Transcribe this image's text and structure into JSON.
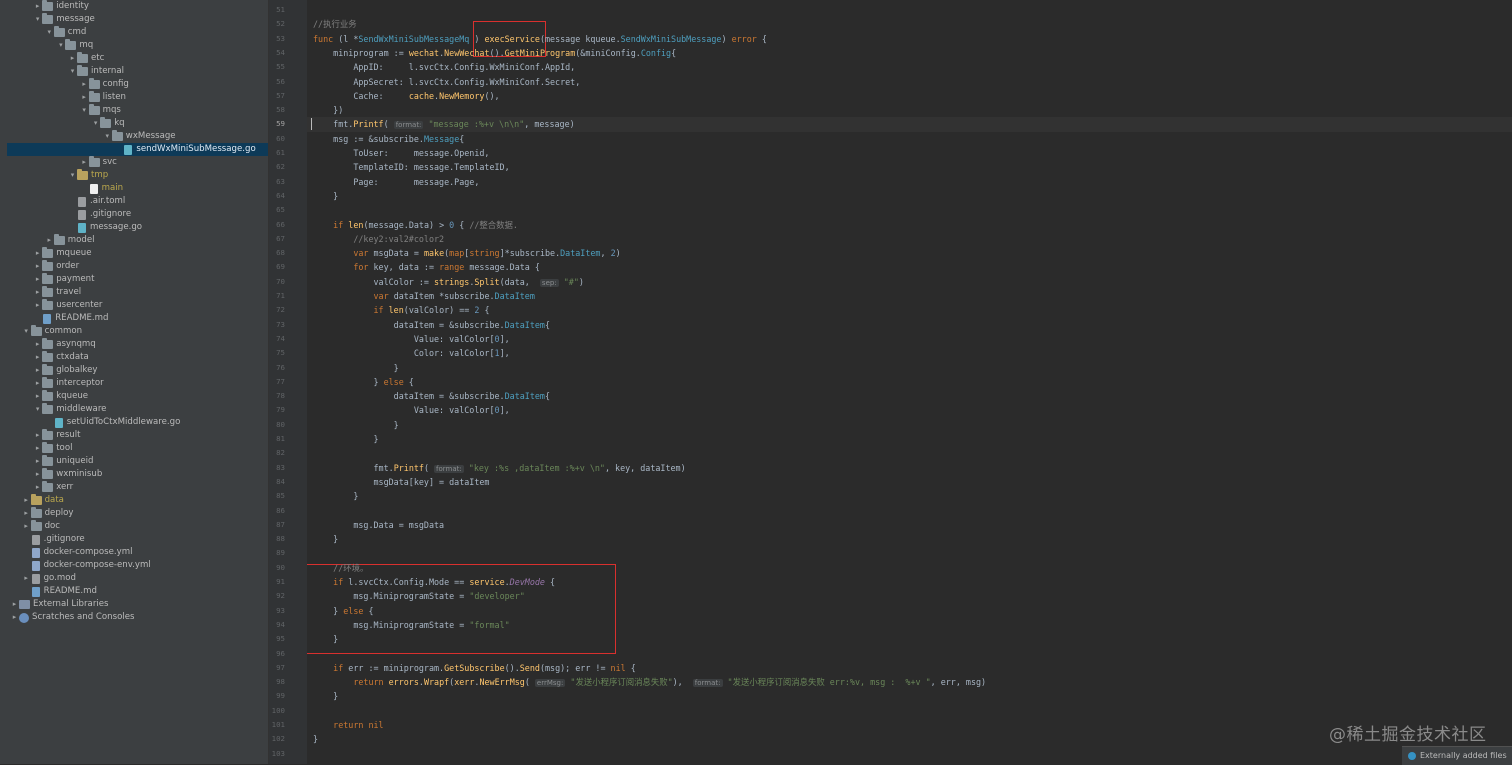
{
  "tree": [
    {
      "label": "identity",
      "depth": 2,
      "kind": "folder",
      "arrow": "▸"
    },
    {
      "label": "message",
      "depth": 2,
      "kind": "folder",
      "arrow": "▾"
    },
    {
      "label": "cmd",
      "depth": 3,
      "kind": "folder",
      "arrow": "▾"
    },
    {
      "label": "mq",
      "depth": 4,
      "kind": "folder",
      "arrow": "▾"
    },
    {
      "label": "etc",
      "depth": 5,
      "kind": "folder",
      "arrow": "▸"
    },
    {
      "label": "internal",
      "depth": 5,
      "kind": "folder",
      "arrow": "▾"
    },
    {
      "label": "config",
      "depth": 6,
      "kind": "folder",
      "arrow": "▸"
    },
    {
      "label": "listen",
      "depth": 6,
      "kind": "folder",
      "arrow": "▸"
    },
    {
      "label": "mqs",
      "depth": 6,
      "kind": "folder",
      "arrow": "▾"
    },
    {
      "label": "kq",
      "depth": 7,
      "kind": "folder",
      "arrow": "▾"
    },
    {
      "label": "wxMessage",
      "depth": 8,
      "kind": "folder",
      "arrow": "▾"
    },
    {
      "label": "sendWxMiniSubMessage.go",
      "depth": 9,
      "kind": "go",
      "arrow": "",
      "selected": true
    },
    {
      "label": "svc",
      "depth": 6,
      "kind": "folder",
      "arrow": "▸"
    },
    {
      "label": "tmp",
      "depth": 5,
      "kind": "folder-y",
      "arrow": "▾",
      "color": "yellow"
    },
    {
      "label": "main",
      "depth": 6,
      "kind": "main",
      "arrow": "",
      "color": "yellow"
    },
    {
      "label": ".air.toml",
      "depth": 5,
      "kind": "cfg",
      "arrow": ""
    },
    {
      "label": ".gitignore",
      "depth": 5,
      "kind": "cfg",
      "arrow": ""
    },
    {
      "label": "message.go",
      "depth": 5,
      "kind": "go",
      "arrow": ""
    },
    {
      "label": "model",
      "depth": 3,
      "kind": "folder",
      "arrow": "▸"
    },
    {
      "label": "mqueue",
      "depth": 2,
      "kind": "folder",
      "arrow": "▸"
    },
    {
      "label": "order",
      "depth": 2,
      "kind": "folder",
      "arrow": "▸"
    },
    {
      "label": "payment",
      "depth": 2,
      "kind": "folder",
      "arrow": "▸"
    },
    {
      "label": "travel",
      "depth": 2,
      "kind": "folder",
      "arrow": "▸"
    },
    {
      "label": "usercenter",
      "depth": 2,
      "kind": "folder",
      "arrow": "▸"
    },
    {
      "label": "README.md",
      "depth": 2,
      "kind": "md",
      "arrow": ""
    },
    {
      "label": "common",
      "depth": 1,
      "kind": "folder",
      "arrow": "▾"
    },
    {
      "label": "asynqmq",
      "depth": 2,
      "kind": "folder",
      "arrow": "▸"
    },
    {
      "label": "ctxdata",
      "depth": 2,
      "kind": "folder",
      "arrow": "▸"
    },
    {
      "label": "globalkey",
      "depth": 2,
      "kind": "folder",
      "arrow": "▸"
    },
    {
      "label": "interceptor",
      "depth": 2,
      "kind": "folder",
      "arrow": "▸"
    },
    {
      "label": "kqueue",
      "depth": 2,
      "kind": "folder",
      "arrow": "▸"
    },
    {
      "label": "middleware",
      "depth": 2,
      "kind": "folder",
      "arrow": "▾"
    },
    {
      "label": "setUidToCtxMiddleware.go",
      "depth": 3,
      "kind": "go",
      "arrow": ""
    },
    {
      "label": "result",
      "depth": 2,
      "kind": "folder",
      "arrow": "▸"
    },
    {
      "label": "tool",
      "depth": 2,
      "kind": "folder",
      "arrow": "▸"
    },
    {
      "label": "uniqueid",
      "depth": 2,
      "kind": "folder",
      "arrow": "▸"
    },
    {
      "label": "wxminisub",
      "depth": 2,
      "kind": "folder",
      "arrow": "▸"
    },
    {
      "label": "xerr",
      "depth": 2,
      "kind": "folder",
      "arrow": "▸"
    },
    {
      "label": "data",
      "depth": 1,
      "kind": "folder-y",
      "arrow": "▸",
      "color": "yellow"
    },
    {
      "label": "deploy",
      "depth": 1,
      "kind": "folder",
      "arrow": "▸"
    },
    {
      "label": "doc",
      "depth": 1,
      "kind": "folder",
      "arrow": "▸"
    },
    {
      "label": ".gitignore",
      "depth": 1,
      "kind": "cfg",
      "arrow": ""
    },
    {
      "label": "docker-compose.yml",
      "depth": 1,
      "kind": "yml",
      "arrow": ""
    },
    {
      "label": "docker-compose-env.yml",
      "depth": 1,
      "kind": "yml",
      "arrow": ""
    },
    {
      "label": "go.mod",
      "depth": 1,
      "kind": "cfg",
      "arrow": "▸"
    },
    {
      "label": "README.md",
      "depth": 1,
      "kind": "md",
      "arrow": ""
    },
    {
      "label": "External Libraries",
      "depth": 0,
      "kind": "lib",
      "arrow": "▸"
    },
    {
      "label": "Scratches and Consoles",
      "depth": 0,
      "kind": "scr",
      "arrow": "▸"
    }
  ],
  "editor": {
    "current_line": 59,
    "lines": [
      {
        "n": 51,
        "t": []
      },
      {
        "n": 52,
        "t": [
          [
            "cm",
            "//执行业务"
          ]
        ]
      },
      {
        "n": 53,
        "t": [
          [
            "kw",
            "func "
          ],
          [
            "",
            "(l *"
          ],
          [
            "ty",
            "SendWxMiniSubMessageMq"
          ],
          [
            "",
            " ) "
          ],
          [
            "fn",
            "execService"
          ],
          [
            "",
            "(message kqueue."
          ],
          [
            "ty",
            "SendWxMiniSubMessage"
          ],
          [
            "",
            ") "
          ],
          [
            "kw",
            "error"
          ],
          [
            "",
            " {"
          ]
        ]
      },
      {
        "n": 54,
        "t": [
          [
            "",
            "    miniprogram := "
          ],
          [
            "fn",
            "wechat"
          ],
          [
            "",
            "."
          ],
          [
            "fn",
            "NewWechat"
          ],
          [
            "",
            "()."
          ],
          [
            "fn",
            "GetMiniProgram"
          ],
          [
            "",
            "(&miniConfig."
          ],
          [
            "ty",
            "Config"
          ],
          [
            "",
            "{"
          ]
        ]
      },
      {
        "n": 55,
        "t": [
          [
            "",
            "        AppID:     l.svcCtx.Config.WxMiniConf.AppId,"
          ]
        ]
      },
      {
        "n": 56,
        "t": [
          [
            "",
            "        AppSecret: l.svcCtx.Config.WxMiniConf.Secret,"
          ]
        ]
      },
      {
        "n": 57,
        "t": [
          [
            "",
            "        Cache:     "
          ],
          [
            "fn",
            "cache"
          ],
          [
            "",
            "."
          ],
          [
            "fn",
            "NewMemory"
          ],
          [
            "",
            "(),"
          ]
        ]
      },
      {
        "n": 58,
        "t": [
          [
            "",
            "    })"
          ]
        ]
      },
      {
        "n": 59,
        "t": [
          [
            "",
            "    fmt."
          ],
          [
            "fn",
            "Printf"
          ],
          [
            "",
            "( "
          ],
          [
            "hint",
            "format:"
          ],
          [
            "st",
            " \"message :%+v \\n\\n\""
          ],
          [
            "",
            ", message)"
          ]
        ]
      },
      {
        "n": 60,
        "t": [
          [
            "",
            "    msg := &subscribe."
          ],
          [
            "ty",
            "Message"
          ],
          [
            "",
            "{"
          ]
        ]
      },
      {
        "n": 61,
        "t": [
          [
            "",
            "        ToUser:     message.Openid,"
          ]
        ]
      },
      {
        "n": 62,
        "t": [
          [
            "",
            "        TemplateID: message.TemplateID,"
          ]
        ]
      },
      {
        "n": 63,
        "t": [
          [
            "",
            "        Page:       message.Page,"
          ]
        ]
      },
      {
        "n": 64,
        "t": [
          [
            "",
            "    }"
          ]
        ]
      },
      {
        "n": 65,
        "t": []
      },
      {
        "n": 66,
        "t": [
          [
            "kw",
            "    if "
          ],
          [
            "fn",
            "len"
          ],
          [
            "",
            "(message.Data) > "
          ],
          [
            "nm",
            "0"
          ],
          [
            "",
            " { "
          ],
          [
            "cm",
            "//整合数据."
          ]
        ]
      },
      {
        "n": 67,
        "t": [
          [
            "cm",
            "        //key2:val2#color2"
          ]
        ]
      },
      {
        "n": 68,
        "t": [
          [
            "kw",
            "        var "
          ],
          [
            "",
            "msgData = "
          ],
          [
            "fn",
            "make"
          ],
          [
            "",
            "("
          ],
          [
            "kw",
            "map"
          ],
          [
            "",
            "["
          ],
          [
            "kw",
            "string"
          ],
          [
            "",
            "]*subscribe."
          ],
          [
            "ty",
            "DataItem"
          ],
          [
            "",
            ", "
          ],
          [
            "nm",
            "2"
          ],
          [
            "",
            ")"
          ]
        ]
      },
      {
        "n": 69,
        "t": [
          [
            "kw",
            "        for "
          ],
          [
            "",
            "key, data := "
          ],
          [
            "kw",
            "range "
          ],
          [
            "",
            "message.Data {"
          ]
        ]
      },
      {
        "n": 70,
        "t": [
          [
            "",
            "            valColor := "
          ],
          [
            "fn",
            "strings"
          ],
          [
            "",
            "."
          ],
          [
            "fn",
            "Split"
          ],
          [
            "",
            "(data,  "
          ],
          [
            "hint",
            "sep:"
          ],
          [
            "st",
            " \"#\""
          ],
          [
            "",
            ")"
          ]
        ]
      },
      {
        "n": 71,
        "t": [
          [
            "kw",
            "            var "
          ],
          [
            "",
            "dataItem *subscribe."
          ],
          [
            "ty",
            "DataItem"
          ]
        ]
      },
      {
        "n": 72,
        "t": [
          [
            "kw",
            "            if "
          ],
          [
            "fn",
            "len"
          ],
          [
            "",
            "(valColor) == "
          ],
          [
            "nm",
            "2"
          ],
          [
            "",
            " {"
          ]
        ]
      },
      {
        "n": 73,
        "t": [
          [
            "",
            "                dataItem = &subscribe."
          ],
          [
            "ty",
            "DataItem"
          ],
          [
            "",
            "{"
          ]
        ]
      },
      {
        "n": 74,
        "t": [
          [
            "",
            "                    Value: valColor["
          ],
          [
            "nm",
            "0"
          ],
          [
            "",
            "],"
          ]
        ]
      },
      {
        "n": 75,
        "t": [
          [
            "",
            "                    Color: valColor["
          ],
          [
            "nm",
            "1"
          ],
          [
            "",
            "],"
          ]
        ]
      },
      {
        "n": 76,
        "t": [
          [
            "",
            "                }"
          ]
        ]
      },
      {
        "n": 77,
        "t": [
          [
            "",
            "            } "
          ],
          [
            "kw",
            "else"
          ],
          [
            "",
            " {"
          ]
        ]
      },
      {
        "n": 78,
        "t": [
          [
            "",
            "                dataItem = &subscribe."
          ],
          [
            "ty",
            "DataItem"
          ],
          [
            "",
            "{"
          ]
        ]
      },
      {
        "n": 79,
        "t": [
          [
            "",
            "                    Value: valColor["
          ],
          [
            "nm",
            "0"
          ],
          [
            "",
            "],"
          ]
        ]
      },
      {
        "n": 80,
        "t": [
          [
            "",
            "                }"
          ]
        ]
      },
      {
        "n": 81,
        "t": [
          [
            "",
            "            }"
          ]
        ]
      },
      {
        "n": 82,
        "t": []
      },
      {
        "n": 83,
        "t": [
          [
            "",
            "            fmt."
          ],
          [
            "fn",
            "Printf"
          ],
          [
            "",
            "( "
          ],
          [
            "hint",
            "format:"
          ],
          [
            "st",
            " \"key :%s ,dataItem :%+v \\n\""
          ],
          [
            "",
            ", key, dataItem)"
          ]
        ]
      },
      {
        "n": 84,
        "t": [
          [
            "",
            "            msgData[key] = dataItem"
          ]
        ]
      },
      {
        "n": 85,
        "t": [
          [
            "",
            "        }"
          ]
        ]
      },
      {
        "n": 86,
        "t": []
      },
      {
        "n": 87,
        "t": [
          [
            "",
            "        msg.Data = msgData"
          ]
        ]
      },
      {
        "n": 88,
        "t": [
          [
            "",
            "    }"
          ]
        ]
      },
      {
        "n": 89,
        "t": []
      },
      {
        "n": 90,
        "t": [
          [
            "cm",
            "    //环境。"
          ]
        ]
      },
      {
        "n": 91,
        "t": [
          [
            "kw",
            "    if "
          ],
          [
            "",
            "l.svcCtx.Config.Mode == "
          ],
          [
            "fn",
            "service"
          ],
          [
            "",
            "."
          ],
          [
            "it",
            "DevMode"
          ],
          [
            "",
            " {"
          ]
        ]
      },
      {
        "n": 92,
        "t": [
          [
            "",
            "        msg.MiniprogramState = "
          ],
          [
            "st",
            "\"developer\""
          ]
        ]
      },
      {
        "n": 93,
        "t": [
          [
            "",
            "    } "
          ],
          [
            "kw",
            "else"
          ],
          [
            "",
            " {"
          ]
        ]
      },
      {
        "n": 94,
        "t": [
          [
            "",
            "        msg.MiniprogramState = "
          ],
          [
            "st",
            "\"formal\""
          ]
        ]
      },
      {
        "n": 95,
        "t": [
          [
            "",
            "    }"
          ]
        ]
      },
      {
        "n": 96,
        "t": []
      },
      {
        "n": 97,
        "t": [
          [
            "kw",
            "    if "
          ],
          [
            "",
            "err := miniprogram."
          ],
          [
            "fn",
            "GetSubscribe"
          ],
          [
            "",
            "()."
          ],
          [
            "fn",
            "Send"
          ],
          [
            "",
            "(msg); err != "
          ],
          [
            "kw",
            "nil"
          ],
          [
            "",
            " {"
          ]
        ]
      },
      {
        "n": 98,
        "t": [
          [
            "kw",
            "        return "
          ],
          [
            "fn",
            "errors"
          ],
          [
            "",
            "."
          ],
          [
            "fn",
            "Wrapf"
          ],
          [
            "",
            "("
          ],
          [
            "fn",
            "xerr"
          ],
          [
            "",
            "."
          ],
          [
            "fn",
            "NewErrMsg"
          ],
          [
            "",
            "( "
          ],
          [
            "hint",
            "errMsg:"
          ],
          [
            "st",
            " \"发送小程序订阅消息失败\""
          ],
          [
            "",
            "),  "
          ],
          [
            "hint",
            "format:"
          ],
          [
            "st",
            " \"发送小程序订阅消息失败 err:%v, msg :  %+v \""
          ],
          [
            "",
            ", err, msg)"
          ]
        ]
      },
      {
        "n": 99,
        "t": [
          [
            "",
            "    }"
          ]
        ]
      },
      {
        "n": 100,
        "t": []
      },
      {
        "n": 101,
        "t": [
          [
            "kw",
            "    return "
          ],
          [
            "kw",
            "nil"
          ]
        ]
      },
      {
        "n": 102,
        "t": [
          [
            "",
            "}"
          ]
        ]
      },
      {
        "n": 103,
        "t": []
      }
    ]
  },
  "watermark": "@稀土掘金技术社区",
  "notification": {
    "text": "Externally added files"
  },
  "colors": {
    "annotation_box": "#d9302e",
    "selection": "#0d3a58"
  }
}
